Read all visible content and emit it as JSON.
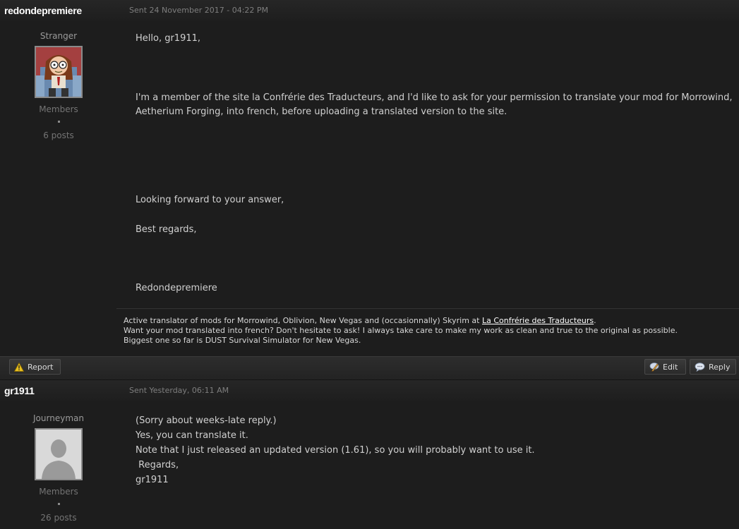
{
  "posts": [
    {
      "author": "redondepremiere",
      "sent": "Sent 24 November 2017 - 04:22 PM",
      "rank": "Stranger",
      "group": "Members",
      "post_count": "6 posts",
      "message": {
        "greeting": "Hello, gr1911,",
        "para1_line1": "I'm a member of the site la Confrérie des Traducteurs, and I'd like to ask for your permission to translate your mod for Morrowind,",
        "para1_line2": "Aetherium Forging, into french, before uploading a translated version to the site.",
        "closing1": "Looking forward to your answer,",
        "closing2": "Best regards,",
        "sign": "Redondepremiere"
      },
      "signature": {
        "line1_pre": "Active translator of mods for Morrowind, Oblivion, New Vegas and (occasionnally) Skyrim at ",
        "line1_link": "La Confrérie des Traducteurs",
        "line1_post": ".",
        "line2": "Want your mod translated into french? Don't hesitate to ask! I always take care to make my work as clean and true to the original as possible.",
        "line3": "Biggest one so far is DUST Survival Simulator for New Vegas."
      },
      "buttons": {
        "report": "Report",
        "edit": "Edit",
        "reply": "Reply"
      }
    },
    {
      "author": "gr1911",
      "sent": "Sent Yesterday, 06:11 AM",
      "rank": "Journeyman",
      "group": "Members",
      "post_count": "26 posts",
      "message": {
        "line1": "(Sorry about weeks-late reply.)",
        "line2": "Yes, you can translate it.",
        "line3": "Note that I just released an updated version (1.61), so you will probably want to use it.",
        "line4": " Regards,",
        "line5": "gr1911"
      }
    }
  ],
  "icons": {
    "report": "warning-triangle-icon",
    "edit": "edit-icon",
    "reply": "speech-bubble-icon"
  },
  "colors": {
    "background": "#1d1d1d",
    "text": "#d0d0d0",
    "warning": "#e8c020"
  }
}
